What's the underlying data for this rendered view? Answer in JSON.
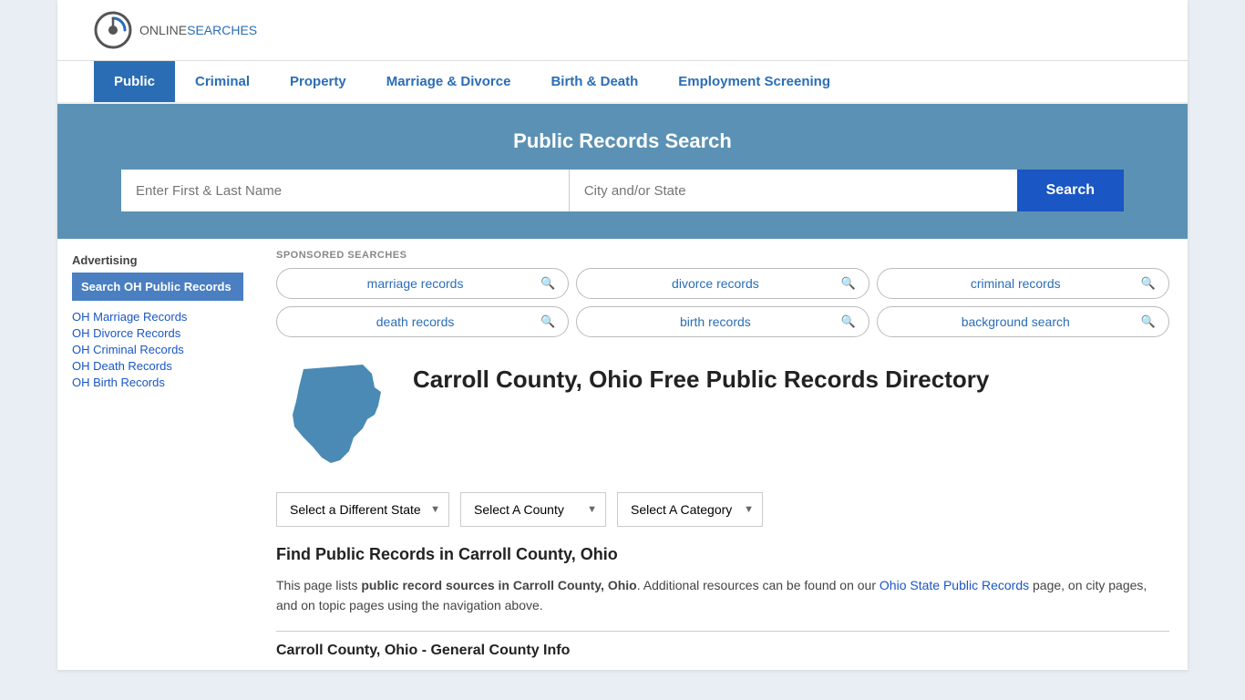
{
  "logo": {
    "online": "ONLINE",
    "searches": "SEARCHES"
  },
  "nav": {
    "items": [
      {
        "label": "Public",
        "active": true
      },
      {
        "label": "Criminal",
        "active": false
      },
      {
        "label": "Property",
        "active": false
      },
      {
        "label": "Marriage & Divorce",
        "active": false
      },
      {
        "label": "Birth & Death",
        "active": false
      },
      {
        "label": "Employment Screening",
        "active": false
      }
    ]
  },
  "hero": {
    "title": "Public Records Search",
    "name_placeholder": "Enter First & Last Name",
    "location_placeholder": "City and/or State",
    "search_button": "Search"
  },
  "sponsored": {
    "label": "SPONSORED SEARCHES",
    "tags": [
      {
        "text": "marriage records"
      },
      {
        "text": "divorce records"
      },
      {
        "text": "criminal records"
      },
      {
        "text": "death records"
      },
      {
        "text": "birth records"
      },
      {
        "text": "background search"
      }
    ]
  },
  "county": {
    "title": "Carroll County, Ohio Free Public Records Directory"
  },
  "dropdowns": {
    "state": "Select a Different State",
    "county": "Select A County",
    "category": "Select A Category"
  },
  "find": {
    "title": "Find Public Records in Carroll County, Ohio",
    "description_start": "This page lists ",
    "bold1": "public record sources in Carroll County, Ohio",
    "description_mid": ". Additional resources can be found on our ",
    "link_text": "Ohio State Public Records",
    "description_end": " page, on city pages, and on topic pages using the navigation above."
  },
  "general_info_title": "Carroll County, Ohio - General County Info",
  "sidebar": {
    "ad_label": "Advertising",
    "ad_button": "Search OH Public Records",
    "links": [
      "OH Marriage Records",
      "OH Divorce Records",
      "OH Criminal Records",
      "OH Death Records",
      "OH Birth Records"
    ]
  }
}
